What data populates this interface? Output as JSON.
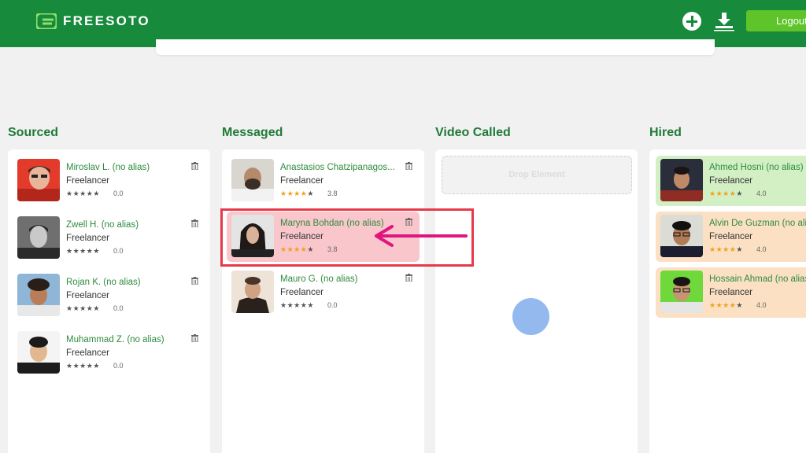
{
  "header": {
    "brand": "FREESOTO",
    "logout_label": "Logout",
    "brand_color": "#178a3b"
  },
  "board": {
    "columns": [
      {
        "title": "Sourced",
        "cards": [
          {
            "name": "Miroslav L.  (no alias)",
            "role": "Freelancer",
            "rating": "0.0",
            "stars": 0
          },
          {
            "name": "Zwell H.  (no alias)",
            "role": "Freelancer",
            "rating": "0.0",
            "stars": 0
          },
          {
            "name": "Rojan K.  (no alias)",
            "role": "Freelancer",
            "rating": "0.0",
            "stars": 0
          },
          {
            "name": "Muhammad Z.  (no alias)",
            "role": "Freelancer",
            "rating": "0.0",
            "stars": 0
          }
        ]
      },
      {
        "title": "Messaged",
        "cards": [
          {
            "name": "Anastasios  Chatzipanagos...",
            "role": "Freelancer",
            "rating": "3.8",
            "stars": 4
          },
          {
            "name": "Maryna Bohdan (no alias)",
            "role": "Freelancer",
            "rating": "3.8",
            "stars": 4
          },
          {
            "name": "Mauro G.  (no alias)",
            "role": "Freelancer",
            "rating": "0.0",
            "stars": 0
          }
        ]
      },
      {
        "title": "Video Called",
        "drop_label": "Drop Element",
        "cards": []
      },
      {
        "title": "Hired",
        "cards": [
          {
            "name": "Ahmed Hosni (no alias)",
            "role": "Freelancer",
            "rating": "4.0",
            "stars": 4
          },
          {
            "name": "Alvin De Guzman (no alias)",
            "role": "Freelancer",
            "rating": "4.0",
            "stars": 4
          },
          {
            "name": "Hossain Ahmad (no alias)",
            "role": "Freelancer",
            "rating": "4.0",
            "stars": 4
          }
        ]
      }
    ]
  }
}
